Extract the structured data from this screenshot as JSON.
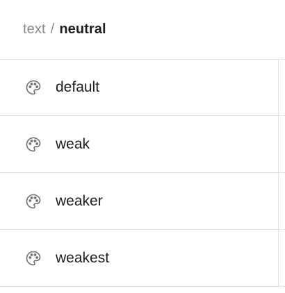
{
  "breadcrumb": {
    "parent": "text",
    "separator": "/",
    "current": "neutral"
  },
  "items": [
    {
      "label": "default",
      "icon": "palette-icon"
    },
    {
      "label": "weak",
      "icon": "palette-icon"
    },
    {
      "label": "weaker",
      "icon": "palette-icon"
    },
    {
      "label": "weakest",
      "icon": "palette-icon"
    }
  ],
  "colors": {
    "divider": "#e2e2e2",
    "muted_text": "#8a8a8a",
    "primary_text": "#1e1e1e",
    "icon": "#6f6f6f"
  }
}
